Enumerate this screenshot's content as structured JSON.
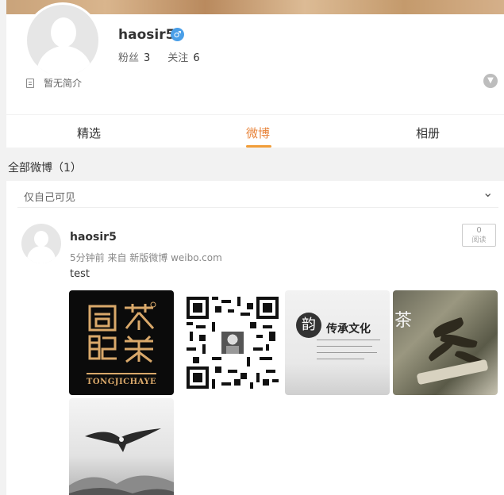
{
  "profile": {
    "username": "haosir5",
    "gender_icon": "male-icon",
    "fans_label": "粉丝",
    "fans_count": "3",
    "following_label": "关注",
    "following_count": "6",
    "bio": "暂无简介"
  },
  "tabs": [
    {
      "label": "精选",
      "active": false
    },
    {
      "label": "微博",
      "active": true
    },
    {
      "label": "相册",
      "active": false
    }
  ],
  "feed": {
    "section_title": "全部微博（1）",
    "visibility_filter": "仅自己可见",
    "post": {
      "username": "haosir5",
      "meta": "5分钟前 来自 新版微博 weibo.com",
      "text": "test",
      "read_count": "0",
      "read_label": "阅读",
      "images": [
        {
          "name": "tongchajiye-logo-image",
          "text_main": "同茶\n記業",
          "text_sub": "TONGJICHAYE"
        },
        {
          "name": "qr-code-image"
        },
        {
          "name": "yun-culture-image",
          "text_main": "韵",
          "text_sub": "传承文化"
        },
        {
          "name": "tea-leaves-image",
          "text_main": "茶"
        },
        {
          "name": "eagle-landscape-image"
        }
      ]
    }
  },
  "colors": {
    "accent": "#e8843b",
    "underline": "#f19d38",
    "gender_badge": "#4a9fe8",
    "logo_gold": "#d9a86a"
  }
}
